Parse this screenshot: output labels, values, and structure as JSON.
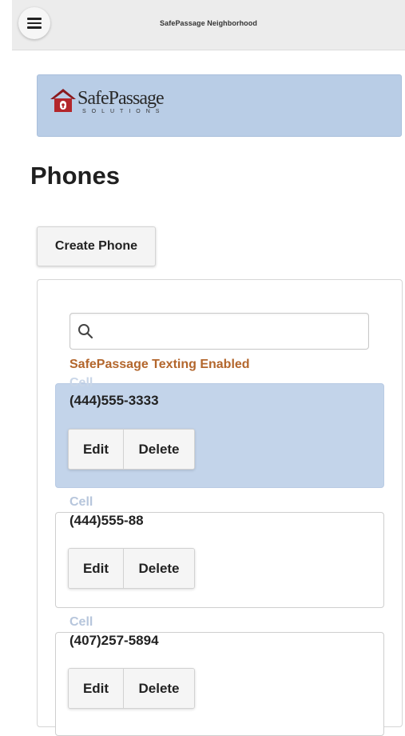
{
  "header": {
    "title": "SafePassage Neighborhood"
  },
  "banner": {
    "logo_name": "SafePassage",
    "logo_sub": "SOLUTIONS",
    "logo_colors": {
      "house": "#b3262b",
      "roof": "#8a1a1e"
    }
  },
  "page": {
    "title": "Phones"
  },
  "toolbar": {
    "create_label": "Create Phone"
  },
  "search": {
    "placeholder": "",
    "value": ""
  },
  "status": {
    "texting": "SafePassage Texting Enabled"
  },
  "phones": [
    {
      "type": "Cell",
      "number": "(444)555-3333",
      "edit_label": "Edit",
      "delete_label": "Delete",
      "selected": true
    },
    {
      "type": "Cell",
      "number": "(444)555-88",
      "edit_label": "Edit",
      "delete_label": "Delete",
      "selected": false
    },
    {
      "type": "Cell",
      "number": "(407)257-5894",
      "edit_label": "Edit",
      "delete_label": "Delete",
      "selected": false
    }
  ],
  "colors": {
    "banner_bg": "#b9cde6",
    "selected_bg": "#c3d4ea",
    "texting_text": "#b3662c"
  },
  "icons": {
    "menu": "hamburger-icon",
    "search": "search-icon",
    "logo": "house-icon"
  }
}
